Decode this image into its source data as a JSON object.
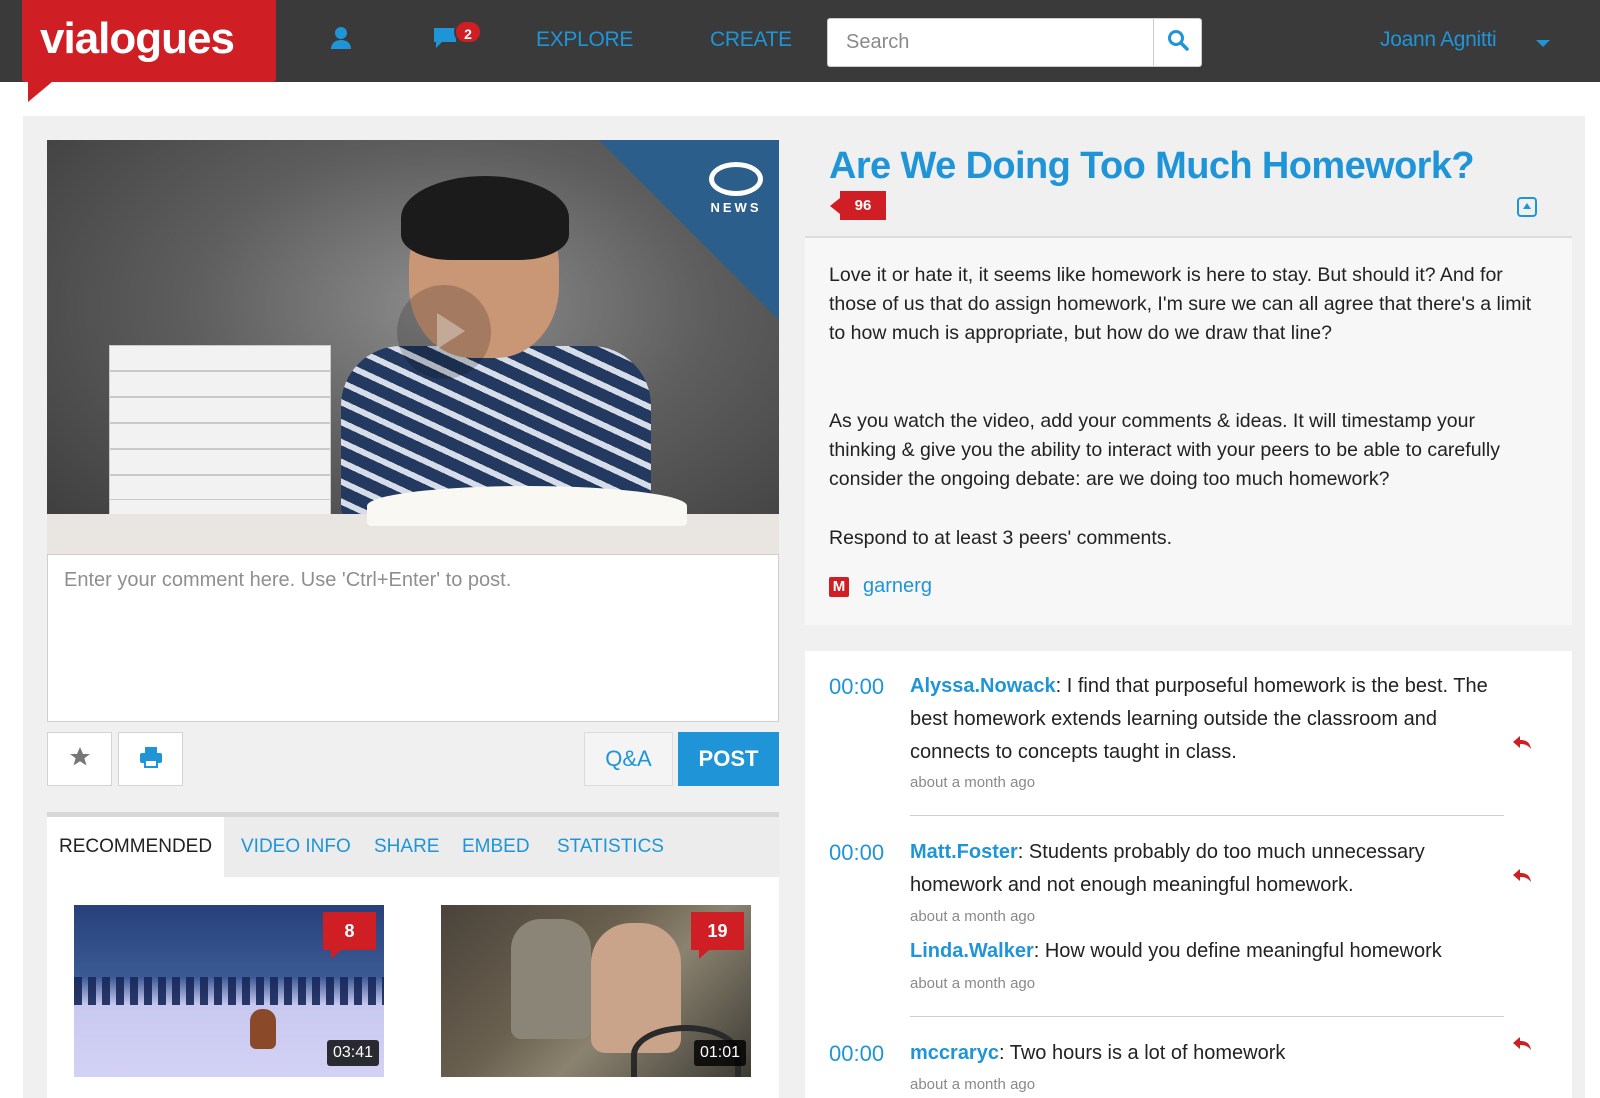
{
  "brand": {
    "logo": "vialogues"
  },
  "nav": {
    "messages_count": "2",
    "explore": "EXPLORE",
    "create": "CREATE",
    "search_placeholder": "Search",
    "username": "Joann Agnitti"
  },
  "video": {
    "corner_logo": "NEWS"
  },
  "comment_input": {
    "placeholder": "Enter your comment here. Use 'Ctrl+Enter' to post."
  },
  "actions": {
    "qa": "Q&A",
    "post": "POST"
  },
  "tabs": [
    {
      "label": "RECOMMENDED"
    },
    {
      "label": "VIDEO INFO"
    },
    {
      "label": "SHARE"
    },
    {
      "label": "EMBED"
    },
    {
      "label": "STATISTICS"
    }
  ],
  "recommended": [
    {
      "count": "8",
      "duration": "03:41"
    },
    {
      "count": "19",
      "duration": "01:01"
    }
  ],
  "vialogue": {
    "title": "Are We Doing Too Much Homework?",
    "views": "96",
    "description": [
      "Love it or hate it, it seems like homework is here to stay. But should it? And for those of us that do assign homework, I'm sure we can all agree that there's a limit to how much is appropriate, but how do we draw that line?",
      "As you watch the video, add your comments & ideas. It will timestamp your thinking & give you the ability to interact with your peers to be able to carefully consider the ongoing debate: are we doing too much homework?",
      "Respond to at least 3 peers' comments."
    ],
    "author_badge": "M",
    "author": "garnerg"
  },
  "comments": [
    {
      "time": "00:00",
      "user": "Alyssa.Nowack",
      "text": "I find that purposeful homework is the best. The best homework extends learning outside the classroom and connects to concepts taught in class.",
      "ago": "about a month ago"
    },
    {
      "time": "00:00",
      "user": "Matt.Foster",
      "text": "Students probably do too much unnecessary homework and not enough meaningful homework.",
      "ago": "about a month ago",
      "reply": {
        "user": "Linda.Walker",
        "text": "How would you define meaningful homework",
        "ago": "about a month ago"
      }
    },
    {
      "time": "00:00",
      "user": "mccraryc",
      "text": "Two hours is a lot of homework",
      "ago": "about a month ago"
    }
  ],
  "colors": {
    "accent": "#1f95d8",
    "brand_red": "#cf1f25",
    "topbar": "#3a3a3a"
  }
}
